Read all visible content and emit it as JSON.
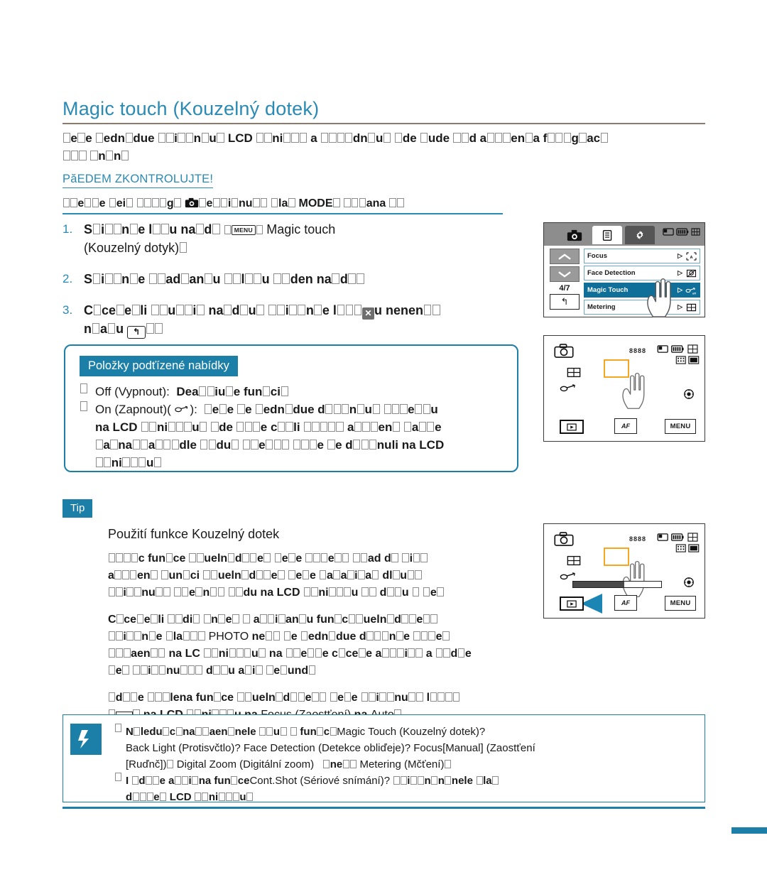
{
  "page": {
    "heading": "Magic touch (Kouzelný dotek)",
    "accent_color": "#1b7fa8",
    "heading_color": "#2a8ab4",
    "rule_color": "#8e7a6a"
  },
  "intro": {
    "line1": "?e?e ?edn?due ??i??n?u? LCD ??ni??? a ????dn?u? ?de ?ude ??d a???en?a f???g?ac?",
    "line2": "??? ?n?n?"
  },
  "check_first": {
    "title": "PăEDEM ZKONTROLUJTE!",
    "line": "??e??e ?ei? ????g ?? ??i??nu?? ?la? MODE ???ana ??",
    "icon_camera": "camera-icon",
    "mode_label": "MODE"
  },
  "steps": [
    {
      "num": "1.",
      "bold_before": "S?i??n?e l??u na?d?",
      "key_icon": "menu-key-icon",
      "gap": "?",
      "plain_after": "Magic touch",
      "line2_plain": "(Kouzelný dotyk)?"
    },
    {
      "num": "2.",
      "bold_before": "S?i??n?e ??ad?an?u ??l??u ??den na?d??"
    },
    {
      "num": "3.",
      "bold_before": "C?ce?e?li ??u??i? na?d?u? ??i??n?e l??u?",
      "key_icon": "close-x-icon",
      "bold_after": "u nenen??",
      "line2_bold": "n?a?u",
      "back_icon": "back-arrow-key-icon",
      "line2_tail": "??"
    }
  ],
  "submenu": {
    "tag": "Položky podťízené nabídky",
    "items": [
      {
        "bullet": "gb",
        "label": "Off (Vypnout):",
        "value": "Dea??iu?e fun?ci?"
      },
      {
        "bullet": "gb",
        "label": "On (Zapnout)(",
        "icon": "magic-touch-icon",
        "label_tail": "):",
        "value": "?e?e ?e ?edn?due d???n?u? ???e??u",
        "line2": "na LCD ??ni???u? ?de ???e c??li ????? a???en? ??a??e",
        "line3": "?a?na??a???dle ??du? ??e??? ???e ?e d???nuli na LCD",
        "line4": "??ni???u?"
      }
    ]
  },
  "tip": {
    "tag": "Tip",
    "heading": "Použití funkce Kouzelný dotek",
    "paragraphs": [
      {
        "lines": [
          "????c fun?ce ??ueln?d??e? ?e?e ???e?? ??ad d? ?i??",
          "a???en? ?un?ci ??ueln?d??e? ?e?e ?a?a?i?a? dl?u??",
          "??i??nu?? ??e?n?? ??du na LCD ??ni???u ?? d??u ? ?e?und?"
        ]
      },
      {
        "lines": [
          "C?ce?e?li ??di??n?e? ? a??i?an?u fun?c??ueln?d??e??",
          "??i??n?e ?la??? PHOTO ne?? ?e ?edn?due d???n?e ???e?",
          "???aen?? na LC ??ni???u? na ??e??e c?ce?e a???i?? a ??d??e",
          "?e? ??i??nu???? d??u a?i? ?e?und?"
        ]
      },
      {
        "lines": [
          "?d??e ???lena fun?ce ??ueln?d??e?? ?e?e ??i??nu?? I?????",
          "?AF? na LCD ??ni???u na Focus (Zaostťení) na Auto?"
        ]
      }
    ]
  },
  "note": {
    "icon": "samsung-note-icon",
    "rows": [
      {
        "bullet": "gb",
        "line1_bold": "N?ledu?c?na??aen?nele ??u? ? fun?c?",
        "line1_plain": "Magic Touch (Kouzelný dotek)?",
        "line2": "Back Light (Protisvčtlo)? Face Detection (Detekce obliďeje)? Focus[Manual] (Zaostťení",
        "line3": "[Ruďnč])? Digital Zoom (Digitální zoom)   ?ne?? Metering (Mčťení)?"
      },
      {
        "bullet": "gb",
        "line1_bold": "I ?d??e a??i?na fun?ce",
        "line1_plain": "Cont.Shot (Sériové snímání)?",
        "line1_bold2": "??i??n?n?nele ?la?",
        "line2_bold": "d???e? LCD ??ni???u?"
      }
    ]
  },
  "lcd_menu": {
    "name": "camera-menu-screen",
    "tabs": [
      {
        "icon": "camera-mode-icon",
        "active": false
      },
      {
        "icon": "menu-list-icon",
        "active": true
      },
      {
        "icon": "settings-gear-icon",
        "active": false
      }
    ],
    "status_icons": [
      "memory-card-icon",
      "battery-icon",
      "grid-icon"
    ],
    "page_indicator": "4/7",
    "nav_up": "up-arrow-icon",
    "nav_down": "down-arrow-icon",
    "nav_back": "back-arrow-icon",
    "rows": [
      {
        "label": "Focus",
        "arrow": "▷",
        "value_icon": "af-auto-icon",
        "selected": false
      },
      {
        "label": "Face Detection",
        "arrow": "▷",
        "value_icon": "face-off-icon",
        "selected": false
      },
      {
        "label": "Magic Touch",
        "arrow": "▷",
        "value_icon": "magic-touch-off-icon",
        "selected": true
      },
      {
        "label": "Metering",
        "arrow": "▷",
        "value_icon": "metering-icon",
        "selected": false
      }
    ],
    "hand_cursor": "hand-pointer-icon"
  },
  "lcd_photo_1": {
    "name": "camera-live-view-screen-1",
    "mode_icon": "photo-camera-icon",
    "counter": "8888",
    "status_icons_row1": [
      "memory-card-icon",
      "battery-icon",
      "resolution-icon"
    ],
    "status_icons_row2": [
      "quality-icon",
      "widescreen-icon"
    ],
    "metering_icon": "metering-icon",
    "magic_touch_icon": "magic-touch-icon",
    "focus_box": "focus-frame",
    "hand_cursor": "hand-pointer-icon",
    "wheel_icon": "control-wheel-icon",
    "btn_play": "play-button",
    "btn_af": "AF",
    "btn_menu": "MENU"
  },
  "lcd_photo_2": {
    "name": "camera-live-view-screen-2",
    "mode_icon": "photo-camera-icon",
    "counter": "8888",
    "status_icons_row1": [
      "memory-card-icon",
      "battery-icon",
      "resolution-icon"
    ],
    "status_icons_row2": [
      "quality-icon",
      "widescreen-icon"
    ],
    "metering_icon": "metering-icon",
    "magic_touch_icon": "magic-touch-icon",
    "focus_box": "focus-frame",
    "hand_cursor": "hand-pointer-icon",
    "wheel_icon": "control-wheel-icon",
    "progress_percent": 58,
    "pointer": "blue-triangle-pointer",
    "btn_play": "play-button",
    "btn_af": "AF",
    "btn_menu": "MENU"
  }
}
